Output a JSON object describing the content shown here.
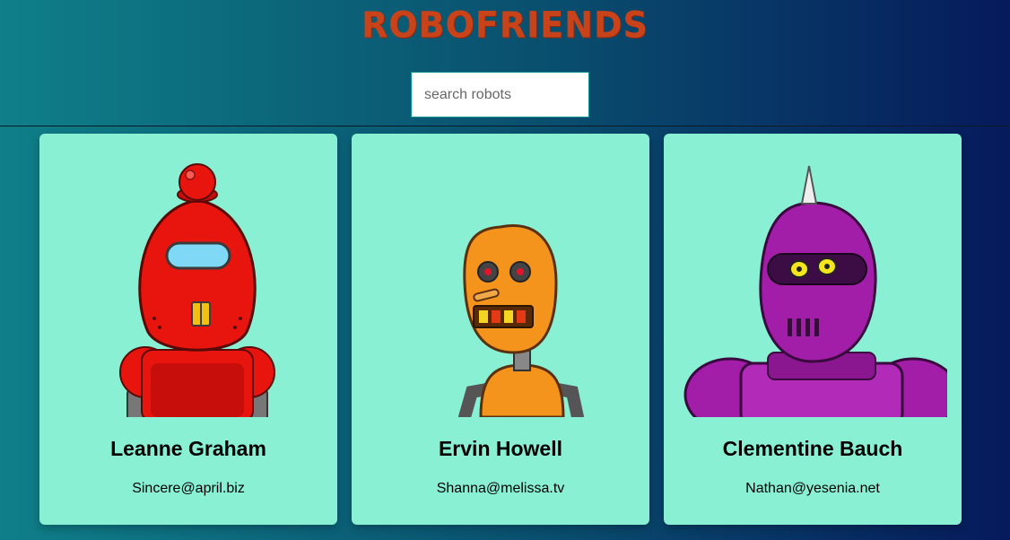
{
  "header": {
    "title": "ROBOFRIENDS"
  },
  "search": {
    "placeholder": "search robots",
    "value": ""
  },
  "robots": [
    {
      "name": "Leanne Graham",
      "email": "Sincere@april.biz",
      "color": "#e8150f"
    },
    {
      "name": "Ervin Howell",
      "email": "Shanna@melissa.tv",
      "color": "#f5941d"
    },
    {
      "name": "Clementine Bauch",
      "email": "Nathan@yesenia.net",
      "color": "#a21ea8"
    }
  ],
  "colors": {
    "card_bg": "#89f0d3",
    "title": "#c8421a",
    "bg_start": "#0f7f88",
    "bg_end": "#061a5c"
  }
}
